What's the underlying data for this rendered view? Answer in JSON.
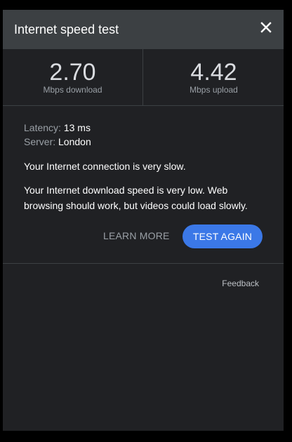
{
  "header": {
    "title": "Internet speed test",
    "close_icon": "close-icon"
  },
  "results": {
    "download": {
      "value": "2.70",
      "unit": "Mbps download"
    },
    "upload": {
      "value": "4.42",
      "unit": "Mbps upload"
    }
  },
  "details": {
    "latency_label": "Latency:",
    "latency_value": "13 ms",
    "server_label": "Server:",
    "server_value": "London",
    "message_summary": "Your Internet connection is very slow.",
    "message_detail": "Your Internet download speed is very low. Web browsing should work, but videos could load slowly."
  },
  "actions": {
    "learn_more": "LEARN MORE",
    "test_again": "TEST AGAIN"
  },
  "footer": {
    "feedback": "Feedback"
  },
  "colors": {
    "panel_bg": "#202124",
    "header_bg": "#3c4043",
    "accent_button": "#3b78e7"
  }
}
